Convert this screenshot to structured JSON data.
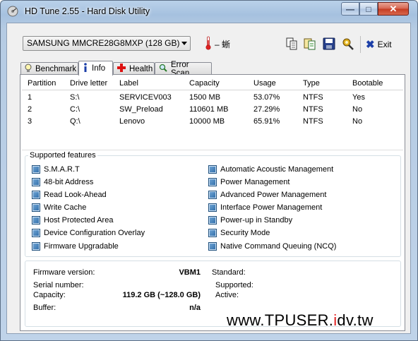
{
  "window": {
    "title": "HD Tune 2.55 - Hard Disk Utility"
  },
  "toolbar": {
    "drive": "SAMSUNG MMCRE28G8MXP (128 GB)",
    "temperature": "– 蜥",
    "exit_label": "Exit"
  },
  "tabs": [
    {
      "label": "Benchmark",
      "icon": "lightbulb-icon"
    },
    {
      "label": "Info",
      "icon": "info-icon"
    },
    {
      "label": "Health",
      "icon": "health-cross-icon"
    },
    {
      "label": "Error Scan",
      "icon": "magnifier-icon"
    }
  ],
  "partitions": {
    "headers": [
      "Partition",
      "Drive letter",
      "Label",
      "Capacity",
      "Usage",
      "Type",
      "Bootable"
    ],
    "rows": [
      [
        "1",
        "S:\\",
        "SERVICEV003",
        "1500 MB",
        "53.07%",
        "NTFS",
        "Yes"
      ],
      [
        "2",
        "C:\\",
        "SW_Preload",
        "110601 MB",
        "27.29%",
        "NTFS",
        "No"
      ],
      [
        "3",
        "Q:\\",
        "Lenovo",
        "10000 MB",
        "65.91%",
        "NTFS",
        "No"
      ]
    ]
  },
  "features": {
    "title": "Supported features",
    "left": [
      "S.M.A.R.T",
      "48-bit Address",
      "Read Look-Ahead",
      "Write Cache",
      "Host Protected Area",
      "Device Configuration Overlay",
      "Firmware Upgradable"
    ],
    "right": [
      "Automatic Acoustic Management",
      "Power Management",
      "Advanced Power Management",
      "Interface Power Management",
      "Power-up in Standby",
      "Security Mode",
      "Native Command Queuing (NCQ)"
    ]
  },
  "info": {
    "firmware_label": "Firmware version:",
    "firmware_value": "VBM1",
    "serial_label": "Serial number:",
    "serial_value": "",
    "capacity_label": "Capacity:",
    "capacity_value": "119.2 GB (~128.0 GB)",
    "buffer_label": "Buffer:",
    "buffer_value": "n/a",
    "standard_label": "Standard:",
    "standard_value": "",
    "supported_label": "Supported:",
    "supported_value": "",
    "active_label": "Active:",
    "active_value": ""
  },
  "watermark": {
    "prefix": "www.TPUSER.",
    "highlight": "i",
    "suffix": "dv.tw"
  },
  "colors": {
    "accent": "#2d6ba7",
    "watermark_red": "#e21c1c"
  }
}
